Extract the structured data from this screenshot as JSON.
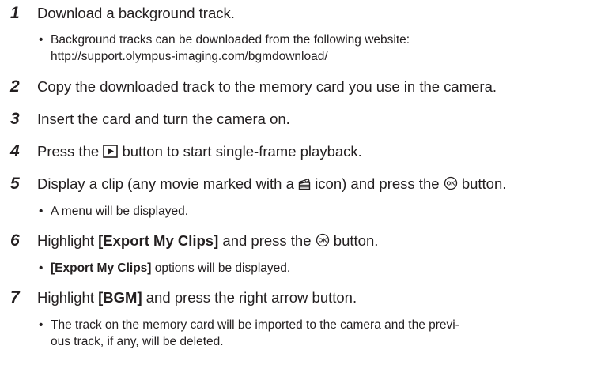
{
  "steps": [
    {
      "number": "1",
      "text": "Download a background track.",
      "notes": [
        {
          "line1": "Background tracks can be downloaded from the following website:",
          "line2": "http://support.olympus-imaging.com/bgmdownload/"
        }
      ]
    },
    {
      "number": "2",
      "text": "Copy the downloaded track to the memory card you use in the camera."
    },
    {
      "number": "3",
      "text": "Insert the card and turn the camera on."
    },
    {
      "number": "4",
      "text_before": "Press the",
      "icon": "playback-button-icon",
      "text_after": "button to start single-frame playback."
    },
    {
      "number": "5",
      "text_before": "Display a clip (any movie marked with a",
      "icon": "clip-icon",
      "text_middle": "icon) and press the",
      "icon2": "ok-button-icon",
      "text_after": "button.",
      "notes": [
        {
          "text": "A menu will be displayed."
        }
      ]
    },
    {
      "number": "6",
      "text_before": "Highlight",
      "bold": "[Export My Clips]",
      "text_middle": "and press the",
      "icon": "ok-button-icon",
      "text_after": "button.",
      "notes": [
        {
          "bold": "[Export My Clips]",
          "text": "options will be displayed."
        }
      ]
    },
    {
      "number": "7",
      "text_before": "Highlight",
      "bold": "[BGM]",
      "text_after": "and press the right arrow button.",
      "notes": [
        {
          "line1": "The track on the memory card will be imported to the camera and the previ-",
          "line2": "ous track, if any, will be deleted."
        }
      ]
    }
  ],
  "bullet": "•"
}
